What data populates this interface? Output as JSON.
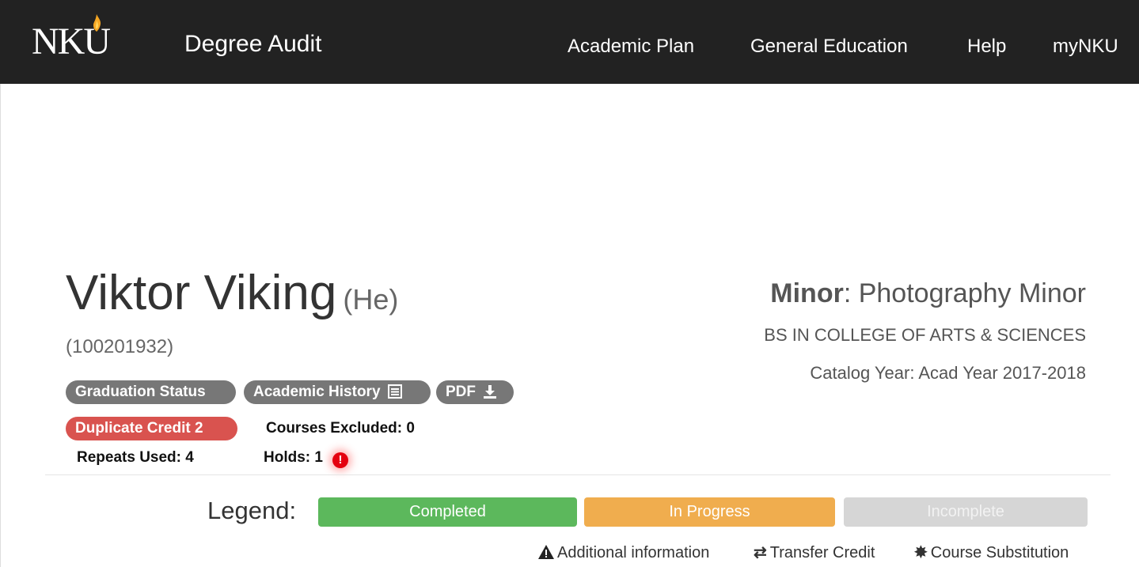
{
  "header": {
    "logo_text": "NKU",
    "app_title": "Degree Audit",
    "nav": [
      "Academic Plan",
      "General Education",
      "Help",
      "myNKU"
    ]
  },
  "student": {
    "name": "Viktor Viking",
    "pronoun": "(He)",
    "id": "(100201932)"
  },
  "buttons": {
    "graduation_status": "Graduation Status",
    "academic_history": "Academic History",
    "pdf": "PDF",
    "duplicate_credit": "Duplicate Credit 2"
  },
  "stats": {
    "courses_excluded": "Courses Excluded: 0",
    "repeats_used": "Repeats Used: 4",
    "holds": "Holds: 1"
  },
  "program": {
    "minor_label": "Minor",
    "minor_value": ": Photography Minor",
    "degree": "BS IN COLLEGE OF ARTS & SCIENCES",
    "catalog": "Catalog Year: Acad Year 2017-2018"
  },
  "legend": {
    "label": "Legend:",
    "items": [
      {
        "label": "Completed",
        "color": "#5cb85c"
      },
      {
        "label": "In Progress",
        "color": "#f0ad4e"
      },
      {
        "label": "Incomplete",
        "color": "#d6d6d6"
      }
    ],
    "notes": [
      "Additional information",
      "Transfer Credit",
      "Course Substitution"
    ]
  }
}
